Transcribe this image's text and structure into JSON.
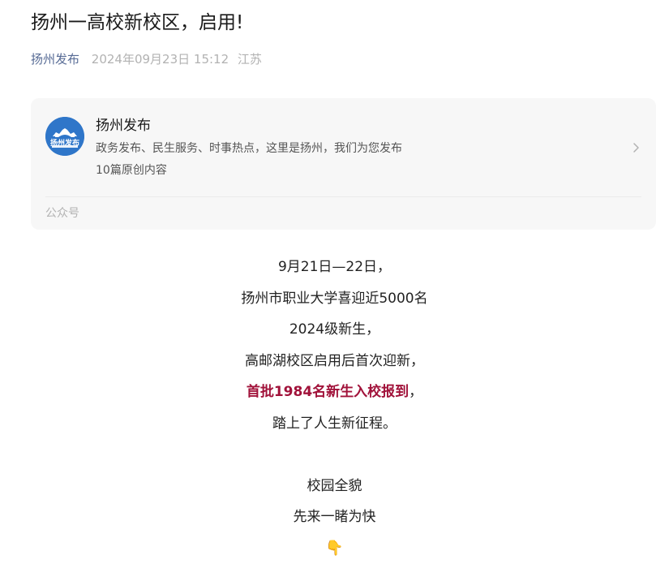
{
  "article": {
    "title": "扬州一高校新校区，启用!",
    "author": "扬州发布",
    "date": "2024年09月23日 15:12",
    "location": "江苏"
  },
  "account_card": {
    "avatar_label": "扬州发布",
    "name": "扬州发布",
    "description": "政务发布、民生服务、时事热点，这里是扬州，我们为您发布",
    "original_count": "10篇原创内容",
    "footer_label": "公众号",
    "accent_color": "#2f76c9"
  },
  "body": {
    "line1": "9月21日—22日，",
    "line2": "扬州市职业大学喜迎近5000名",
    "line3": "2024级新生，",
    "line4": "高邮湖校区启用后首次迎新，",
    "line5_highlight": "首批1984名新生入校报到",
    "line5_tail": "，",
    "line6": "踏上了人生新征程。",
    "line7": "校园全貌",
    "line8": "先来一睹为快",
    "pointer_emoji": "👇",
    "highlight_color": "#a1123a"
  },
  "colors": {
    "author_link": "#576b95",
    "muted_text": "#b2b2b2",
    "card_bg": "#f7f7f7"
  },
  "icons": {
    "chevron": "chevron-right-icon",
    "pointer": "pointing-down-icon"
  }
}
